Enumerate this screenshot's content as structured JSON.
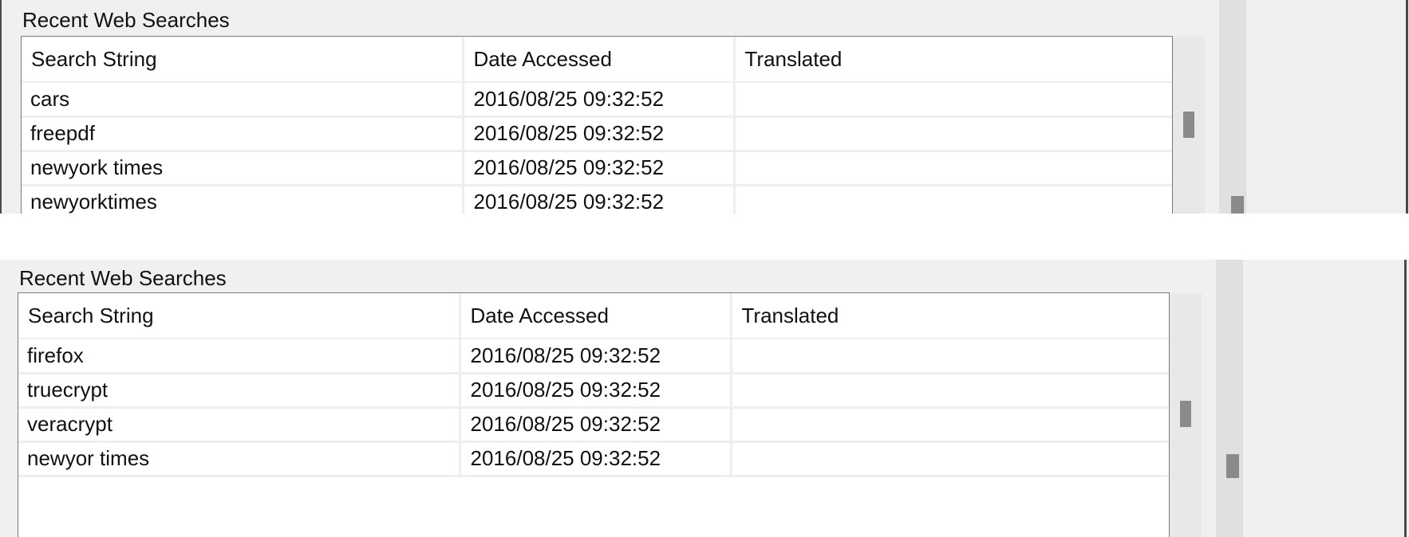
{
  "panels": [
    {
      "title": "Recent Web Searches",
      "columns": [
        "Search String",
        "Date Accessed",
        "Translated"
      ],
      "rows": [
        {
          "search": "cars",
          "date": "2016/08/25 09:32:52",
          "translated": ""
        },
        {
          "search": "freepdf",
          "date": "2016/08/25 09:32:52",
          "translated": ""
        },
        {
          "search": "newyork times",
          "date": "2016/08/25 09:32:52",
          "translated": ""
        },
        {
          "search": "newyorktimes",
          "date": "2016/08/25 09:32:52",
          "translated": ""
        }
      ]
    },
    {
      "title": "Recent Web Searches",
      "columns": [
        "Search String",
        "Date Accessed",
        "Translated"
      ],
      "rows": [
        {
          "search": "firefox",
          "date": "2016/08/25 09:32:52",
          "translated": ""
        },
        {
          "search": "truecrypt",
          "date": "2016/08/25 09:32:52",
          "translated": ""
        },
        {
          "search": "veracrypt",
          "date": "2016/08/25 09:32:52",
          "translated": ""
        },
        {
          "search": "newyor times",
          "date": "2016/08/25 09:32:52",
          "translated": ""
        }
      ]
    }
  ],
  "colors": {
    "panel_bg": "#f0f0f0",
    "table_bg": "#ffffff",
    "grid_line": "#eeeeee",
    "scroll_thumb": "#8a8a8a"
  }
}
